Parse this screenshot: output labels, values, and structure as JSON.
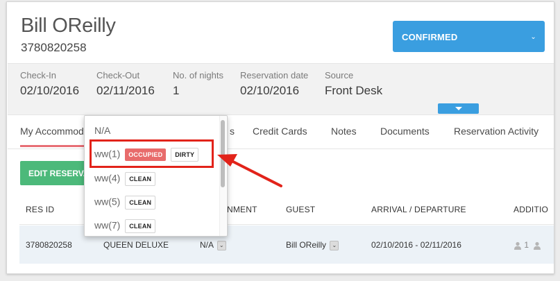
{
  "guest": {
    "name": "Bill OReilly",
    "reservation_number": "3780820258"
  },
  "status": {
    "value": "CONFIRMED",
    "chevron": "⌄"
  },
  "summary": [
    {
      "label": "Check-In",
      "value": "02/10/2016"
    },
    {
      "label": "Check-Out",
      "value": "02/11/2016"
    },
    {
      "label": "No. of nights",
      "value": "1"
    },
    {
      "label": "Reservation date",
      "value": "02/10/2016"
    },
    {
      "label": "Source",
      "value": "Front Desk"
    }
  ],
  "tabs": [
    "My Accommoda",
    "s",
    "Credit Cards",
    "Notes",
    "Documents",
    "Reservation Activity"
  ],
  "edit_button": "EDIT RESERVATI",
  "table": {
    "headers": [
      "RES ID",
      "NMENT",
      "GUEST",
      "ARRIVAL / DEPARTURE",
      "ADDITIO"
    ],
    "row": {
      "res_id": "3780820258",
      "room_type": "QUEEN DELUXE",
      "assignment": "N/A",
      "guest": "Bill OReilly",
      "dates": "02/10/2016 - 02/11/2016",
      "adults": "1"
    }
  },
  "room_dropdown": {
    "items": [
      {
        "label": "N/A",
        "badges": []
      },
      {
        "label": "ww(1)",
        "badges": [
          "OCCUPIED",
          "DIRTY"
        ]
      },
      {
        "label": "ww(4)",
        "badges": [
          "CLEAN"
        ]
      },
      {
        "label": "ww(5)",
        "badges": [
          "CLEAN"
        ]
      },
      {
        "label": "ww(7)",
        "badges": [
          "CLEAN"
        ]
      }
    ]
  },
  "colors": {
    "primary": "#3a9ee0",
    "success": "#4cb97a",
    "danger": "#e86b6b",
    "callout": "#e2231a",
    "active_tab": "#e76f76"
  },
  "icons": {
    "status_chevron": "chevron-down-icon",
    "expand": "caret-down-icon",
    "person": "person-icon"
  }
}
